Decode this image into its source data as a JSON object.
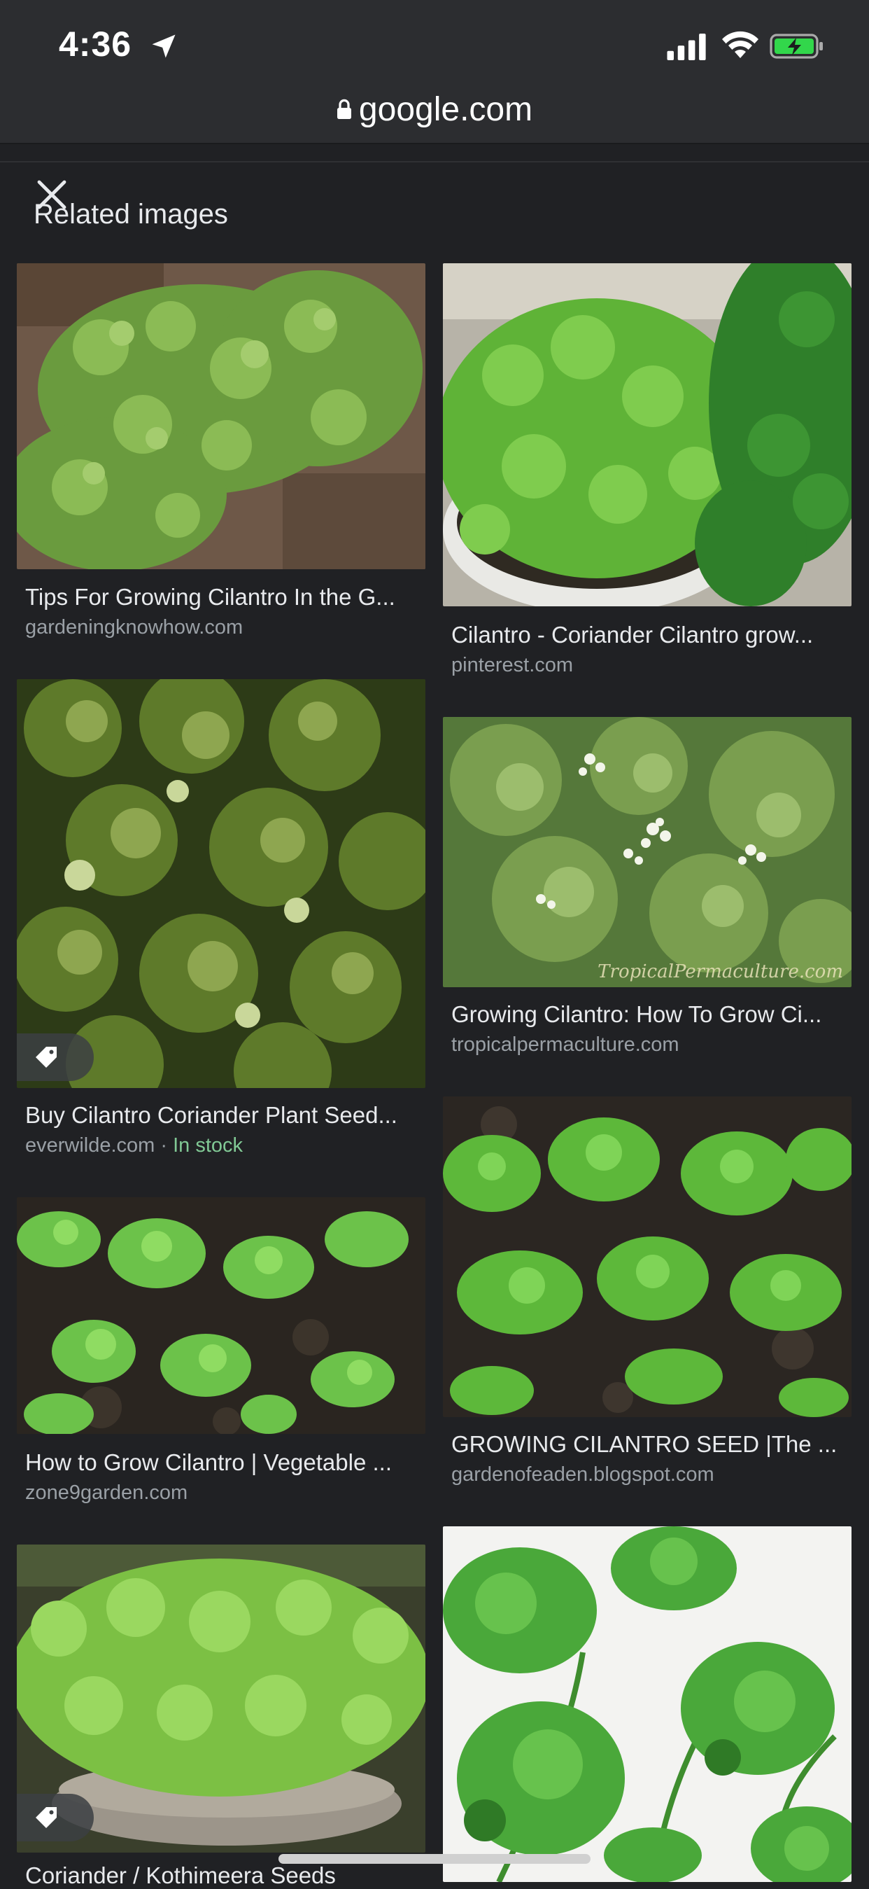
{
  "status_bar": {
    "time": "4:36"
  },
  "browser": {
    "url": "google.com"
  },
  "section": {
    "title": "Related images"
  },
  "results": [
    {
      "title": "Tips For Growing Cilantro In the G...",
      "source": "gardeningknowhow.com"
    },
    {
      "title": "Cilantro - Coriander Cilantro grow...",
      "source": "pinterest.com"
    },
    {
      "title": "Buy Cilantro Coriander Plant Seed...",
      "source": "everwilde.com",
      "separator": " · ",
      "stock": "In stock"
    },
    {
      "title": "Growing Cilantro: How To Grow Ci...",
      "source": "tropicalpermaculture.com",
      "watermark": "TropicalPermaculture.com"
    },
    {
      "title": "How to Grow Cilantro | Vegetable ...",
      "source": "zone9garden.com"
    },
    {
      "title": "GROWING CILANTRO SEED |The ...",
      "source": "gardenofeaden.blogspot.com"
    },
    {
      "title": "Coriander / Kothimeera Seeds",
      "source": ""
    },
    {
      "title": "",
      "source": ""
    }
  ],
  "colors": {
    "background": "#202124",
    "chrome": "#2c2d30",
    "source_text": "#9aa0a6",
    "stock_green": "#81c995"
  },
  "icons": [
    "location-arrow-icon",
    "signal-icon",
    "wifi-icon",
    "battery-charging-icon",
    "lock-icon",
    "close-icon",
    "tag-icon"
  ]
}
